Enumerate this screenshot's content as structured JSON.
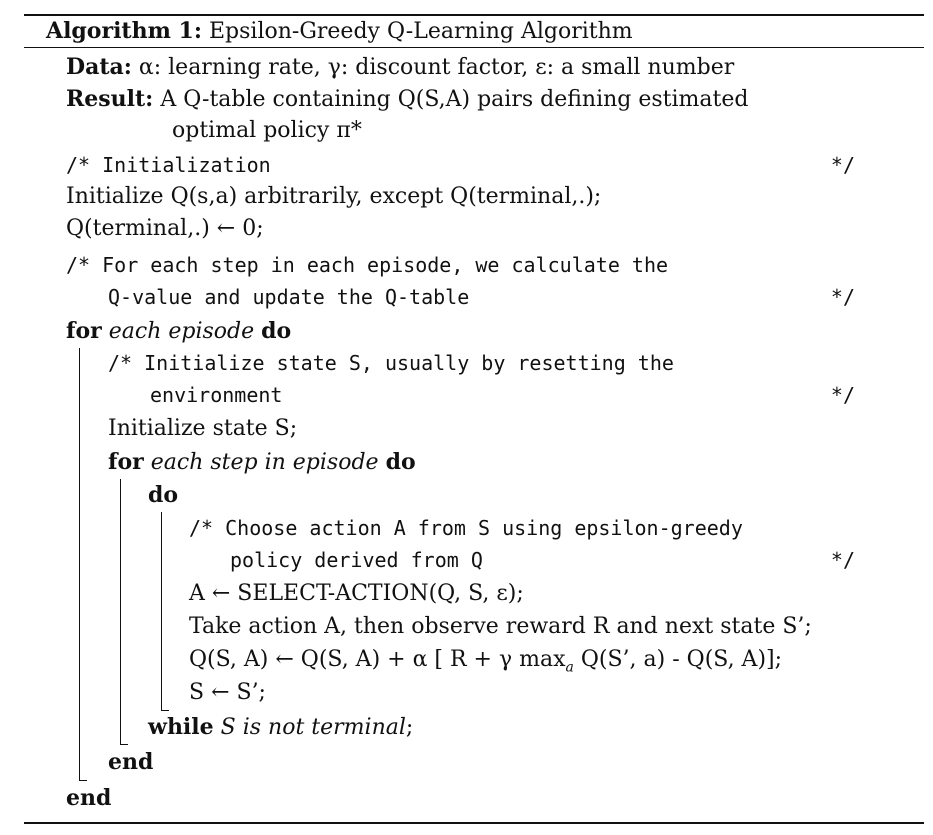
{
  "caption": {
    "label": "Algorithm 1:",
    "title": "Epsilon-Greedy Q-Learning Algorithm"
  },
  "data_line": {
    "label": "Data:",
    "text": "α: learning rate, γ: discount factor, ε: a small number"
  },
  "result_line": {
    "label": "Result:",
    "text1": "A Q-table containing Q(S,A) pairs defining estimated",
    "text2": "optimal policy π*"
  },
  "comment_init": {
    "text": "/* Initialization",
    "end": "*/"
  },
  "init_q": "Initialize Q(s,a) arbitrarily, except Q(terminal,.);",
  "set_terminal": "Q(terminal,.) ← 0;",
  "comment_steps": {
    "text1": "/* For each step in each episode, we calculate the",
    "text2": "Q-value and update the Q-table",
    "end": "*/"
  },
  "for_episode": {
    "kw_for": "for",
    "cond": "each episode",
    "kw_do": "do"
  },
  "comment_state": {
    "text1": "/* Initialize state S, usually by resetting the",
    "text2": "environment",
    "end": "*/"
  },
  "init_state": "Initialize state S;",
  "for_step": {
    "kw_for": "for",
    "cond": "each step in episode",
    "kw_do": "do"
  },
  "do_kw": "do",
  "comment_action": {
    "text1": "/* Choose action A from S using epsilon-greedy",
    "text2": "policy derived from Q",
    "end": "*/"
  },
  "select_action": "A ← SELECT-ACTION(Q, S, ε);",
  "take_action": "Take action A, then observe reward R and next state S’;",
  "update_q": {
    "pre": "Q(S, A) ← Q(S, A) + α [ R + γ max",
    "sub": "a",
    "post": " Q(S’, a) - Q(S, A)];"
  },
  "assign_s": "S ← S’;",
  "while_line": {
    "kw": "while",
    "cond": "S is not terminal",
    "tail": ";"
  },
  "end_inner": "end",
  "end_outer": "end"
}
